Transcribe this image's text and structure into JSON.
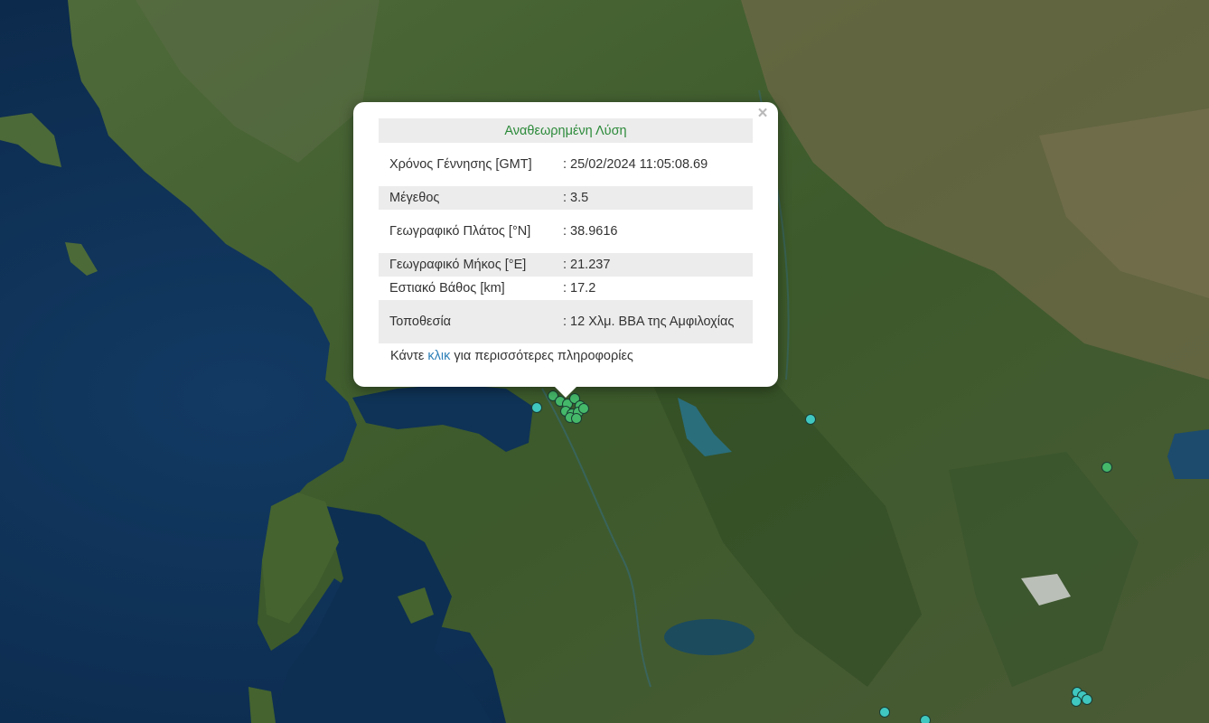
{
  "popup": {
    "header": "Αναθεωρημένη Λύση",
    "close": "×",
    "rows": [
      {
        "label": "Χρόνος Γέννησης [GMT]",
        "value": ": 25/02/2024 11:05:08.69"
      },
      {
        "label": "Μέγεθος",
        "value": ": 3.5"
      },
      {
        "label": "Γεωγραφικό Πλάτος [°N]",
        "value": ": 38.9616"
      },
      {
        "label": "Γεωγραφικό Μήκος [°E]",
        "value": ": 21.237"
      },
      {
        "label": "Εστιακό Βάθος [km]",
        "value": ": 17.2"
      },
      {
        "label": "Τοποθεσία",
        "value": ": 12 Χλμ. ΒΒΑ της Αμφιλοχίας"
      }
    ],
    "footer_prefix": "Κάντε ",
    "footer_link": "κλικ",
    "footer_suffix": " για περισσότερες πληροφορίες"
  },
  "colors": {
    "sea": "#0e2d4f",
    "land": "#3d5a2c",
    "marker_teal": "#3fc7c0",
    "marker_green": "#45b86a",
    "header_green": "#2c8a3a",
    "link": "#2d7fb8"
  }
}
